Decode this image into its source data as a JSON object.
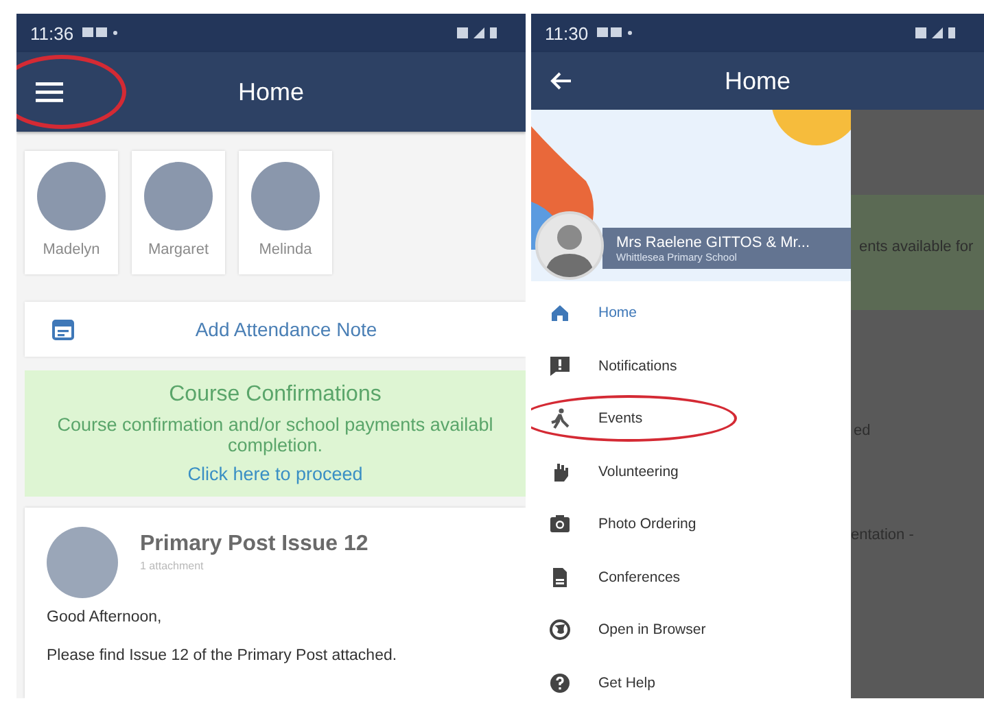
{
  "left_screen": {
    "status_bar": {
      "time": "11:36"
    },
    "app_bar": {
      "title": "Home",
      "annotated": true
    },
    "children": [
      {
        "name": "Madelyn"
      },
      {
        "name": "Margaret"
      },
      {
        "name": "Melinda"
      }
    ],
    "attendance": {
      "label": "Add Attendance Note"
    },
    "notice": {
      "title": "Course Confirmations",
      "body_lines": [
        "Course confirmation and/or school payments availabl",
        "completion."
      ],
      "link": "Click here to proceed"
    },
    "post": {
      "title": "Primary Post Issue 12",
      "subtitle": "1 attachment",
      "paragraphs": [
        "Good Afternoon,",
        "Please find Issue 12 of the Primary Post attached."
      ]
    }
  },
  "right_screen": {
    "status_bar": {
      "time": "11:30"
    },
    "app_bar": {
      "title": "Home"
    },
    "drawer": {
      "user_name": "Mrs Raelene GITTOS & Mr...",
      "school": "Whittlesea Primary School",
      "items": [
        {
          "kind": "home",
          "label": "Home",
          "selected": true,
          "annotated": false
        },
        {
          "kind": "notifications",
          "label": "Notifications",
          "selected": false,
          "annotated": false
        },
        {
          "kind": "events",
          "label": "Events",
          "selected": false,
          "annotated": true
        },
        {
          "kind": "volunteering",
          "label": "Volunteering",
          "selected": false,
          "annotated": false
        },
        {
          "kind": "photo",
          "label": "Photo Ordering",
          "selected": false,
          "annotated": false
        },
        {
          "kind": "conferences",
          "label": "Conferences",
          "selected": false,
          "annotated": false
        },
        {
          "kind": "browser",
          "label": "Open in Browser",
          "selected": false,
          "annotated": false
        },
        {
          "kind": "help",
          "label": "Get Help",
          "selected": false,
          "annotated": false
        }
      ]
    },
    "background_texts": [
      "ents available for",
      "ed",
      "entation -"
    ]
  }
}
